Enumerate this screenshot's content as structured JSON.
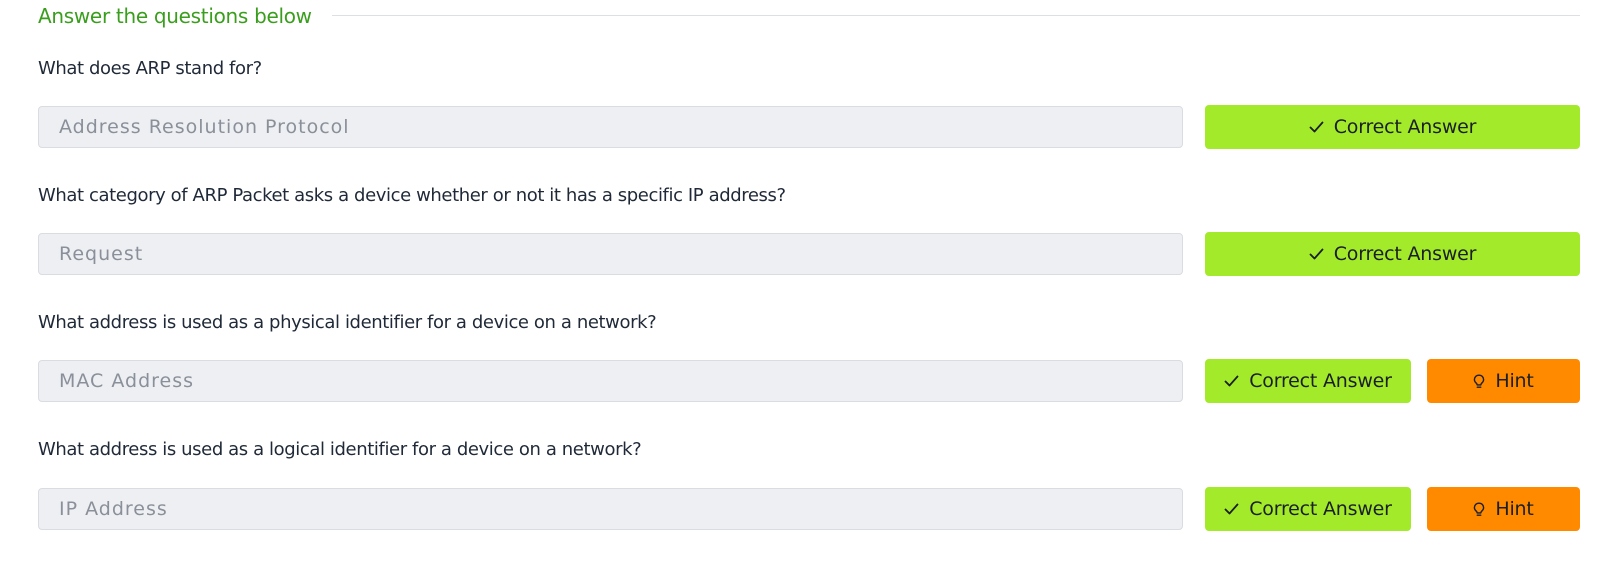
{
  "section": {
    "title": "Answer the questions below"
  },
  "questions": [
    {
      "text": "What does ARP stand for?",
      "answer": "Address Resolution Protocol",
      "correct_label": "Correct Answer"
    },
    {
      "text": "What category of ARP Packet asks a device whether or not it has a specific IP address?",
      "answer": "Request",
      "correct_label": "Correct Answer"
    },
    {
      "text": "What address is used as a physical identifier for a device on a network?",
      "answer": "MAC Address",
      "correct_label": "Correct Answer",
      "hint_label": "Hint"
    },
    {
      "text": "What address is used as a logical identifier for a device on a network?",
      "answer": "IP Address",
      "correct_label": "Correct Answer",
      "hint_label": "Hint"
    }
  ],
  "icons": {
    "correct": "check-icon",
    "hint": "lightbulb-icon"
  },
  "colors": {
    "accent_title": "#3a9e1d",
    "correct_button": "#a3eb2a",
    "hint_button": "#ff8a00",
    "answer_field_bg": "#eeeff2"
  }
}
